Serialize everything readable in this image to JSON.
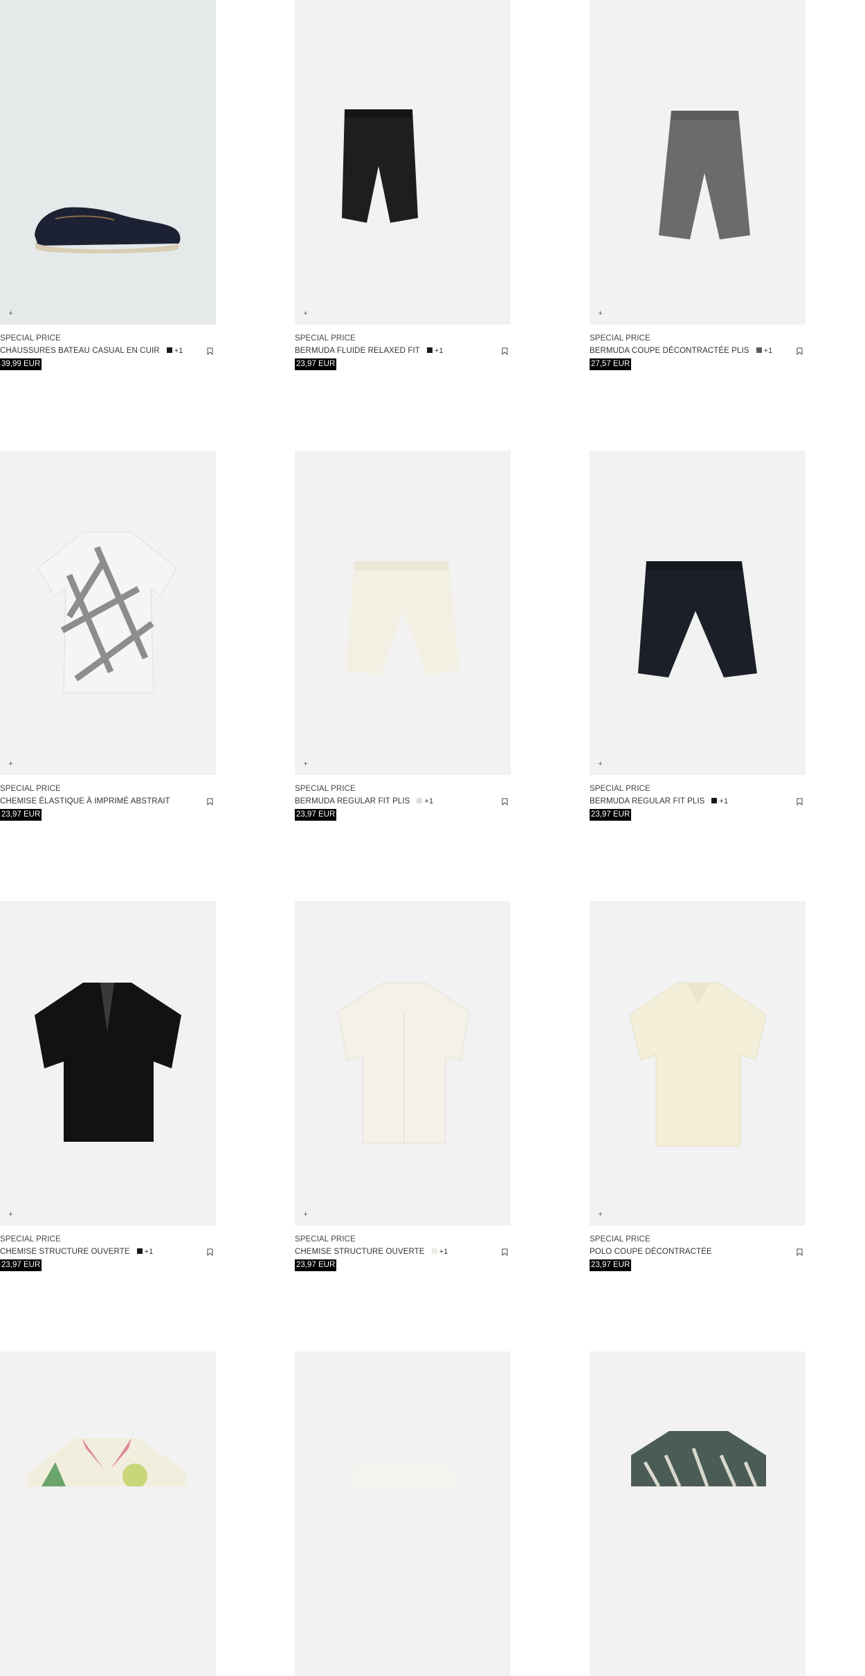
{
  "products": [
    {
      "label": "SPECIAL PRICE",
      "name": "CHAUSSURES BATEAU CASUAL EN CUIR",
      "swatch": "#1a1a1a",
      "more": "+1",
      "price": "39,99 EUR",
      "icon": "boat-shoe-image"
    },
    {
      "label": "SPECIAL PRICE",
      "name": "BERMUDA FLUIDE RELAXED FIT",
      "swatch": "#1a1a1a",
      "more": "+1",
      "price": "23,97 EUR",
      "icon": "black-shorts-image"
    },
    {
      "label": "SPECIAL PRICE",
      "name": "BERMUDA COUPE DÉCONTRACTÉE PLIS",
      "swatch": "#5a5a5a",
      "more": "+1",
      "price": "27,57 EUR",
      "icon": "grey-shorts-image"
    },
    {
      "label": "SPECIAL PRICE",
      "name": "CHEMISE ÉLASTIQUE À IMPRIMÉ ABSTRAIT",
      "price": "23,97 EUR",
      "icon": "print-shirt-image"
    },
    {
      "label": "SPECIAL PRICE",
      "name": "BERMUDA REGULAR FIT PLIS",
      "swatch": "#e0ddd6",
      "more": "+1",
      "price": "23,97 EUR",
      "icon": "cream-shorts-image"
    },
    {
      "label": "SPECIAL PRICE",
      "name": "BERMUDA REGULAR FIT PLIS",
      "swatch": "#1a1a1a",
      "more": "+1",
      "price": "23,97 EUR",
      "icon": "navy-shorts-image"
    },
    {
      "label": "SPECIAL PRICE",
      "name": "CHEMISE STRUCTURE OUVERTE",
      "swatch": "#1a1a1a",
      "more": "+1",
      "price": "23,97 EUR",
      "icon": "black-shirt-image"
    },
    {
      "label": "SPECIAL PRICE",
      "name": "CHEMISE STRUCTURE OUVERTE",
      "swatch": "#eeebe3",
      "more": "+1",
      "price": "23,97 EUR",
      "icon": "white-shirt-image"
    },
    {
      "label": "SPECIAL PRICE",
      "name": "POLO COUPE DÉCONTRACTÉE",
      "price": "23,97 EUR",
      "icon": "polo-image"
    }
  ],
  "add_icon": "+",
  "bookmark_icon": "bookmark-icon"
}
